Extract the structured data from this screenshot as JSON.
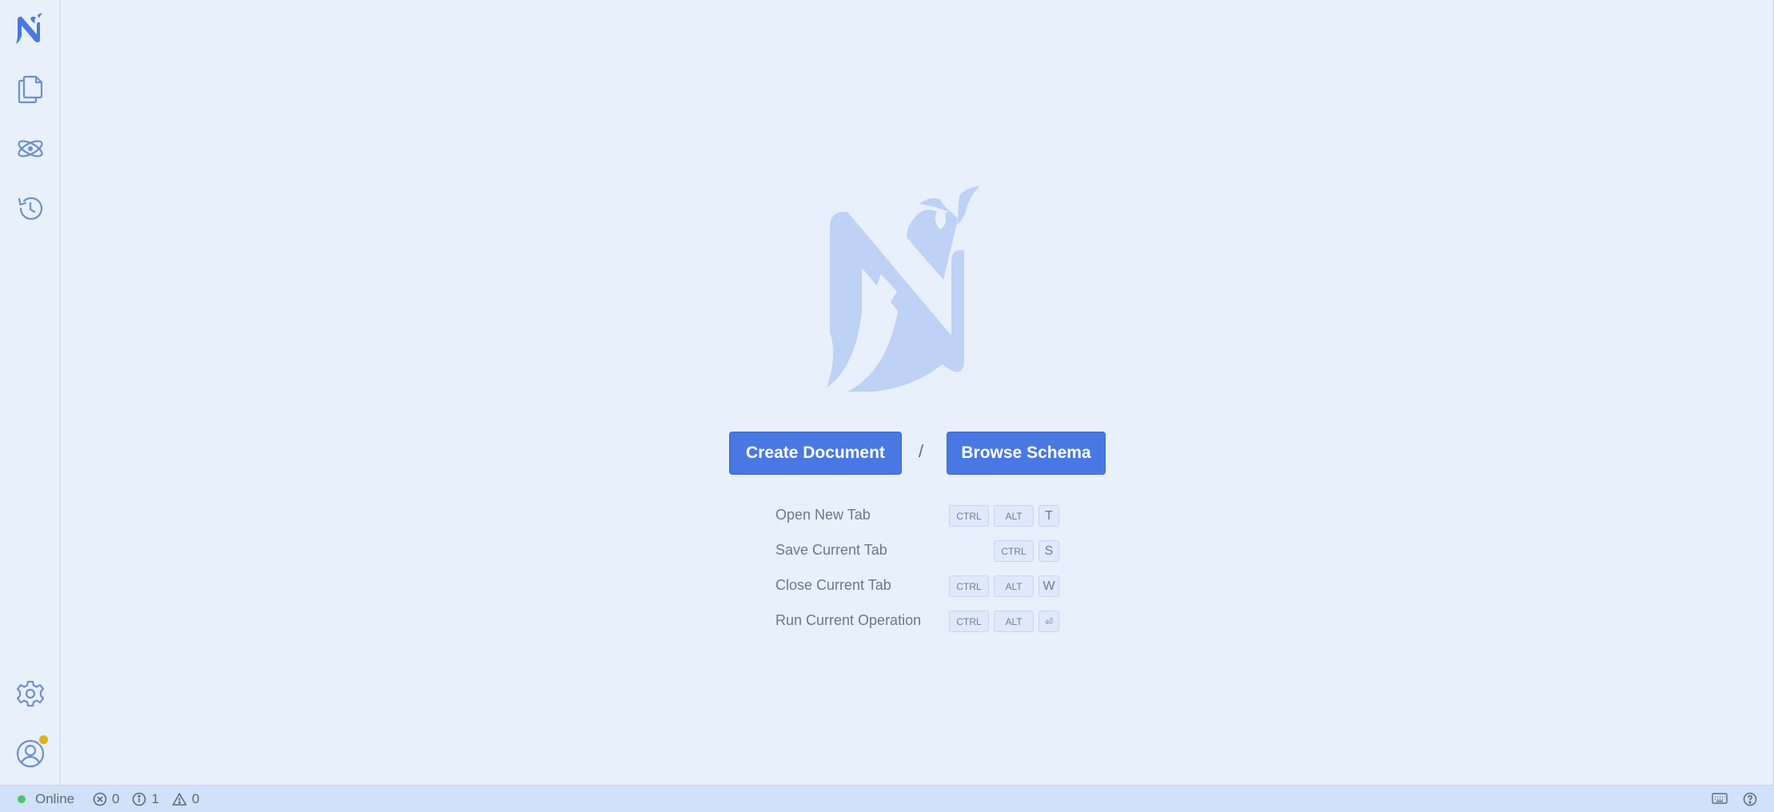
{
  "actions": {
    "create_document": "Create Document",
    "separator": "/",
    "browse_schema": "Browse Schema"
  },
  "shortcuts": [
    {
      "label": "Open New Tab",
      "keys": [
        "CTRL",
        "ALT",
        "T"
      ]
    },
    {
      "label": "Save Current Tab",
      "keys": [
        "CTRL",
        "S"
      ]
    },
    {
      "label": "Close Current Tab",
      "keys": [
        "CTRL",
        "ALT",
        "W"
      ]
    },
    {
      "label": "Run Current Operation",
      "keys": [
        "CTRL",
        "ALT",
        "⏎"
      ]
    }
  ],
  "status": {
    "connection": "Online",
    "errors": "0",
    "infos": "1",
    "warnings": "0"
  },
  "icons": {
    "logo": "app-logo-icon",
    "documents": "documents-icon",
    "schema": "atom-icon",
    "history": "history-icon",
    "settings": "gear-icon",
    "account": "user-icon",
    "keyboard": "keyboard-icon",
    "help": "help-icon"
  },
  "colors": {
    "accent": "#4a78e2",
    "background": "#e8f0fc",
    "statusbar": "#d0e1f8",
    "online": "#4fc36e",
    "notification": "#e2b019"
  }
}
